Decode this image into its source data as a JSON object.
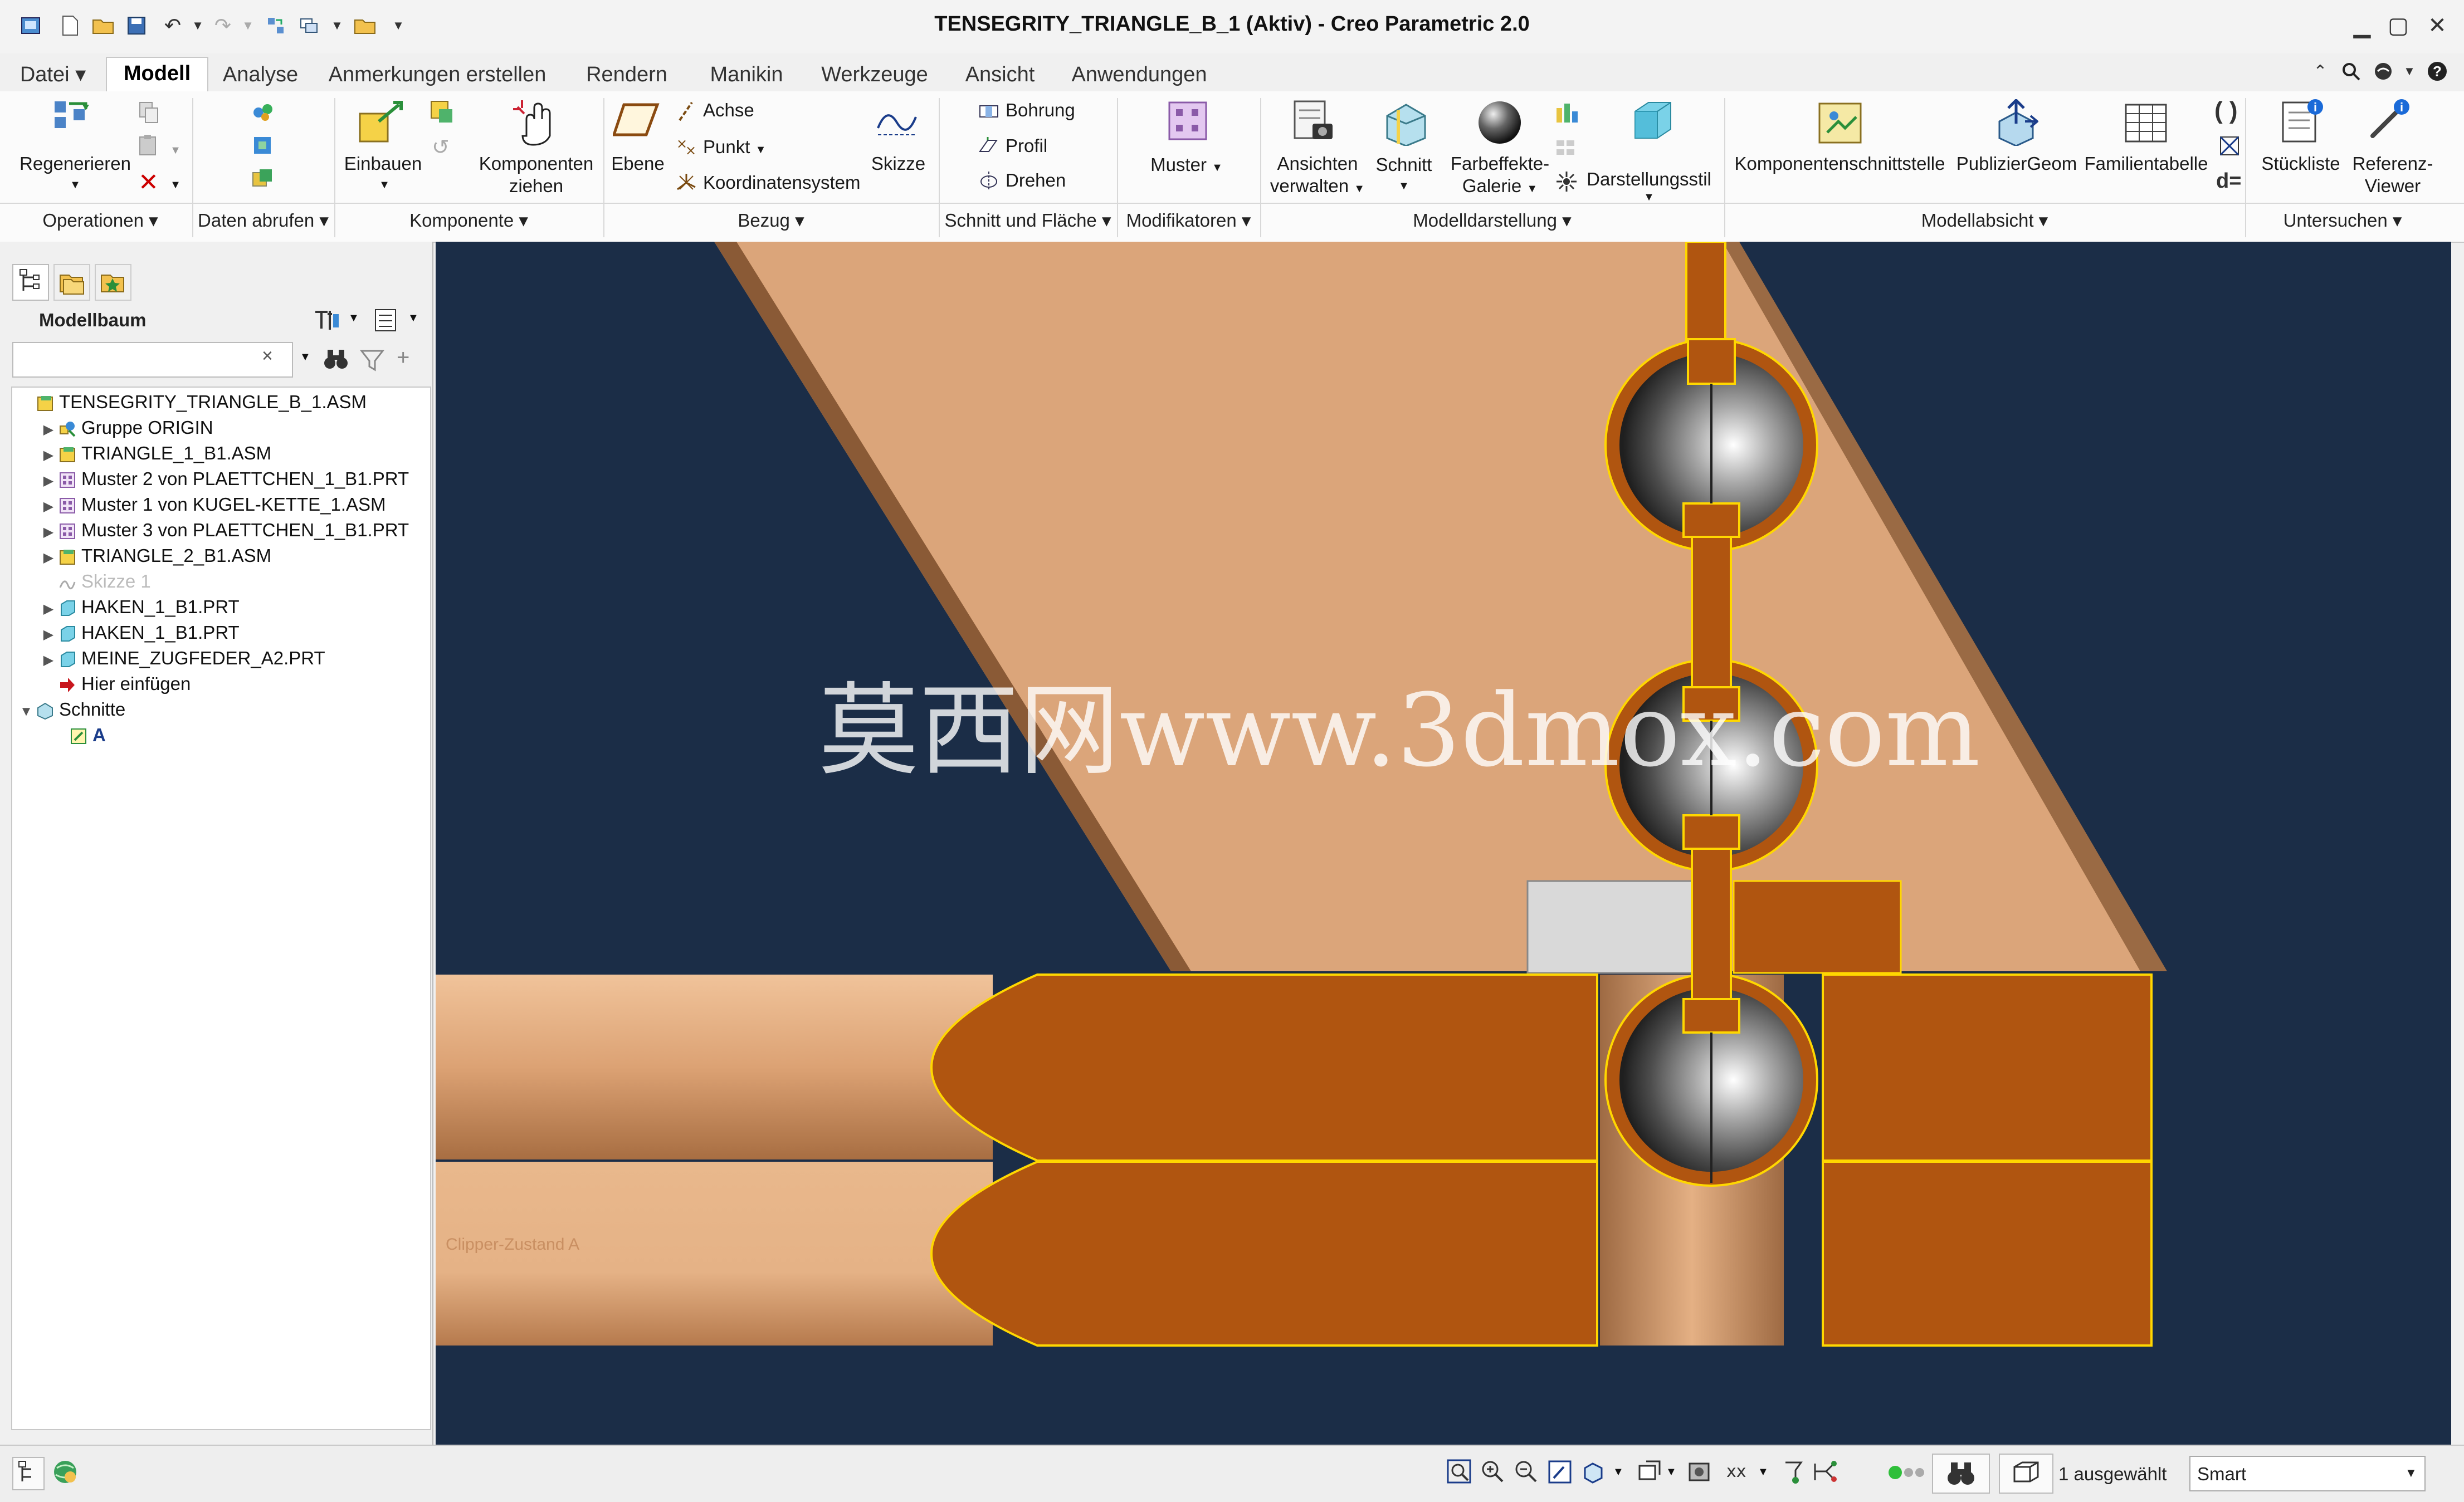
{
  "window": {
    "title": "TENSEGRITY_TRIANGLE_B_1 (Aktiv) - Creo Parametric 2.0"
  },
  "tabs": [
    "Datei",
    "Modell",
    "Analyse",
    "Anmerkungen erstellen",
    "Rendern",
    "Manikin",
    "Werkzeuge",
    "Ansicht",
    "Anwendungen"
  ],
  "active_tab": "Modell",
  "ribbon": {
    "regenerieren": "Regenerieren",
    "einbauen": "Einbauen",
    "komponenten_ziehen_1": "Komponenten",
    "komponenten_ziehen_2": "ziehen",
    "ebene": "Ebene",
    "achse": "Achse",
    "punkt": "Punkt",
    "koordinatensystem": "Koordinatensystem",
    "skizze": "Skizze",
    "bohrung": "Bohrung",
    "profil": "Profil",
    "drehen": "Drehen",
    "muster": "Muster",
    "ansichten_1": "Ansichten",
    "ansichten_2": "verwalten",
    "schnitt": "Schnitt",
    "farbeffekte_1": "Farbeffekte-",
    "farbeffekte_2": "Galerie",
    "darstellungsstil": "Darstellungsstil",
    "komponentenschnittstelle": "Komponentenschnittstelle",
    "publiziergeom": "PublizierGeom",
    "familientabelle": "Familientabelle",
    "stueckliste": "Stückliste",
    "referenz_1": "Referenz-",
    "referenz_2": "Viewer",
    "groups": {
      "operationen": "Operationen",
      "daten_abrufen": "Daten abrufen",
      "komponente": "Komponente",
      "bezug": "Bezug",
      "schnitt_flaeche": "Schnitt und Fläche",
      "modifikatoren": "Modifikatoren",
      "modelldarstellung": "Modelldarstellung",
      "modellabsicht": "Modellabsicht",
      "untersuchen": "Untersuchen"
    }
  },
  "modelltree": {
    "title": "Modellbaum",
    "items": [
      {
        "label": "TENSEGRITY_TRIANGLE_B_1.ASM",
        "indent": 0,
        "arrow": "",
        "icon": "assembly-icon",
        "dim": false
      },
      {
        "label": "Gruppe ORIGIN",
        "indent": 1,
        "arrow": "▶",
        "icon": "group-icon",
        "dim": false
      },
      {
        "label": "TRIANGLE_1_B1.ASM",
        "indent": 1,
        "arrow": "▶",
        "icon": "assembly-icon",
        "dim": false
      },
      {
        "label": "Muster 2 von PLAETTCHEN_1_B1.PRT",
        "indent": 1,
        "arrow": "▶",
        "icon": "pattern-icon",
        "dim": false
      },
      {
        "label": "Muster 1 von KUGEL-KETTE_1.ASM",
        "indent": 1,
        "arrow": "▶",
        "icon": "pattern-icon",
        "dim": false
      },
      {
        "label": "Muster 3 von PLAETTCHEN_1_B1.PRT",
        "indent": 1,
        "arrow": "▶",
        "icon": "pattern-icon",
        "dim": false
      },
      {
        "label": "TRIANGLE_2_B1.ASM",
        "indent": 1,
        "arrow": "▶",
        "icon": "assembly-icon",
        "dim": false
      },
      {
        "label": "Skizze 1",
        "indent": 1,
        "arrow": "",
        "icon": "sketch-icon",
        "dim": true
      },
      {
        "label": "HAKEN_1_B1.PRT",
        "indent": 1,
        "arrow": "▶",
        "icon": "part-icon",
        "dim": false
      },
      {
        "label": "HAKEN_1_B1.PRT",
        "indent": 1,
        "arrow": "▶",
        "icon": "part-icon",
        "dim": false
      },
      {
        "label": "MEINE_ZUGFEDER_A2.PRT",
        "indent": 1,
        "arrow": "▶",
        "icon": "part-icon",
        "dim": false
      },
      {
        "label": "Hier einfügen",
        "indent": 1,
        "arrow": "",
        "icon": "insert-arrow-icon",
        "dim": false
      },
      {
        "label": "Schnitte",
        "indent": 0,
        "arrow": "▼",
        "icon": "sections-icon",
        "dim": false
      },
      {
        "label": "A",
        "indent": 2,
        "arrow": "",
        "icon": "section-a-icon",
        "dim": false
      }
    ]
  },
  "viewport": {
    "watermark": "莫西网www.3dmox.com",
    "section_label": "Clipper-Zustand A"
  },
  "status": {
    "selected": "1 ausgewählt",
    "filter": "Smart"
  },
  "colors": {
    "viewport_bg": "#1b2d47",
    "plate": "#dba57a",
    "section_cut": "#b05510",
    "highlight": "#ffd700"
  }
}
